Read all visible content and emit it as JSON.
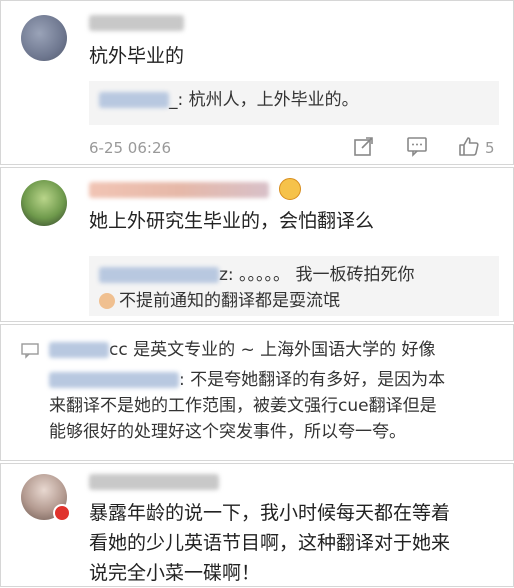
{
  "comments": [
    {
      "text": "杭外毕业的",
      "reply_text": "_: 杭州人，上外毕业的。",
      "time": "6-25 06:26",
      "like_count": "5"
    },
    {
      "text": "她上外研究生毕业的，会怕翻译么",
      "reply_line1": "z: 。。。。。 我一板砖拍死你",
      "reply_line2": "不提前通知的翻译都是耍流氓"
    },
    {
      "header_text": "cc 是英文专业的 ~   上海外国语大学的 好像",
      "line1": ": 不是夸她翻译的有多好，是因为本",
      "line2": "来翻译不是她的工作范围，被姜文强行cue翻译但是",
      "line3": "能够很好的处理好这个突发事件，所以夸一夸。"
    },
    {
      "line1": "暴露年龄的说一下，我小时候每天都在等着",
      "line2": "看她的少儿英语节目啊，这种翻译对于她来",
      "line3": "说完全小菜一碟啊！"
    }
  ],
  "icons": {
    "share": "share-icon",
    "comment": "comment-icon",
    "like": "thumbs-up-icon"
  }
}
